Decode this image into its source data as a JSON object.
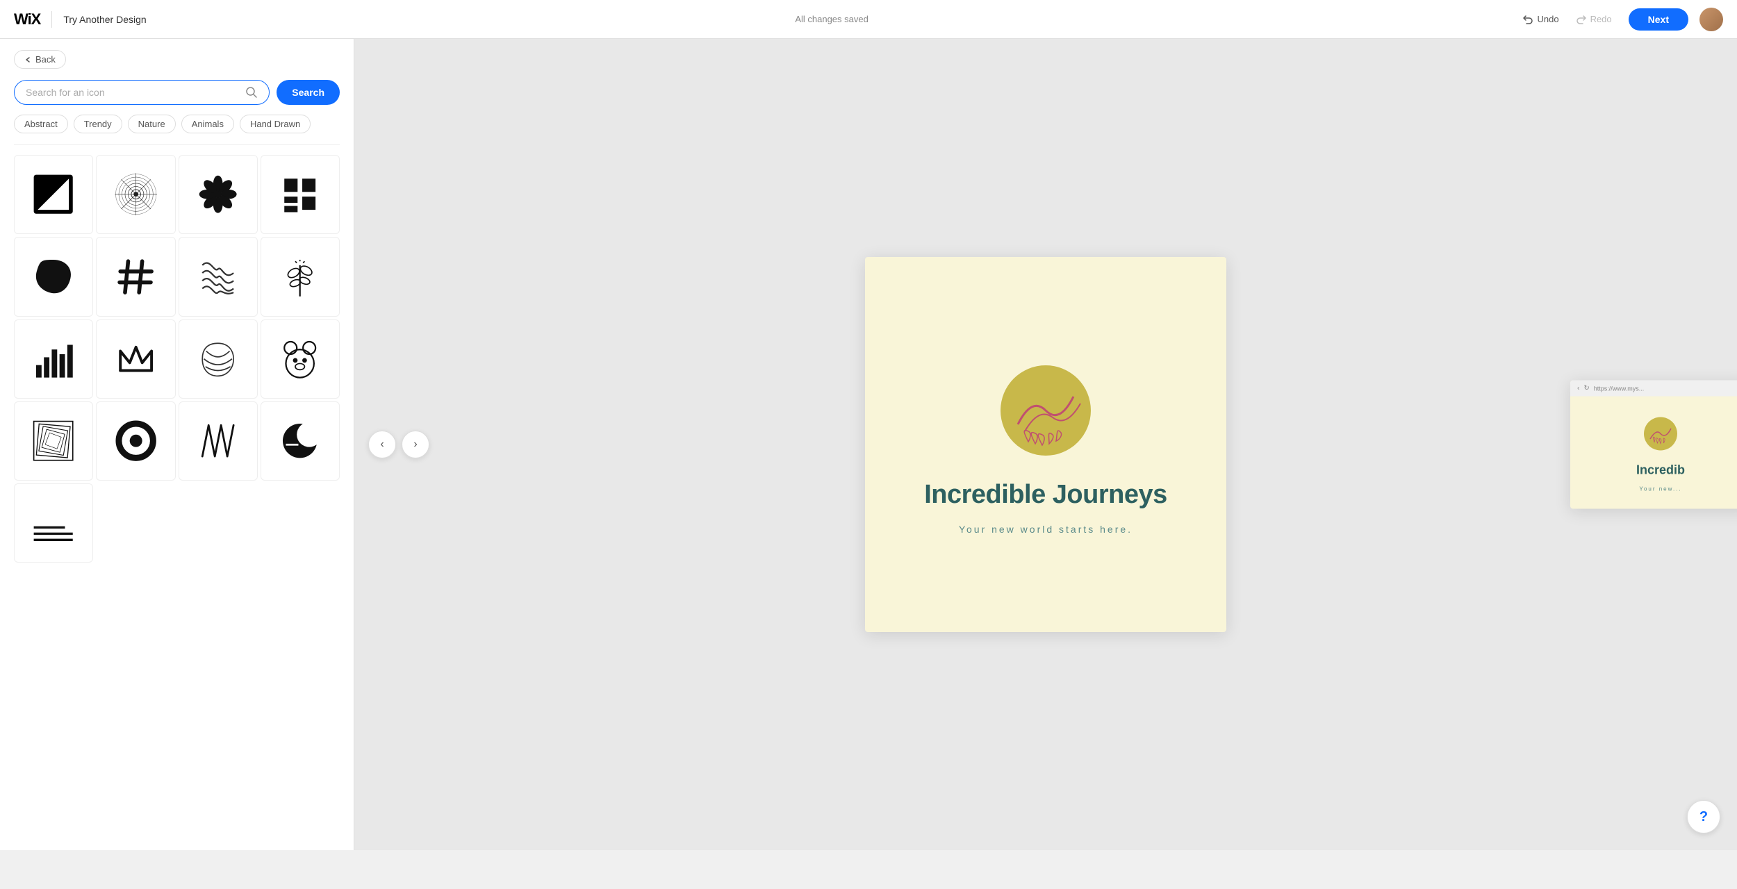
{
  "topbar": {
    "wix_logo": "WiX",
    "try_another": "Try Another Design",
    "status": "All changes saved",
    "undo_label": "Undo",
    "redo_label": "Redo",
    "next_label": "Next"
  },
  "left_panel": {
    "back_label": "Back",
    "search_placeholder": "Search for an icon",
    "search_btn_label": "Search",
    "filter_tags": [
      "Abstract",
      "Trendy",
      "Nature",
      "Animals",
      "Hand Drawn"
    ]
  },
  "logo_card": {
    "title": "Incredible Journeys",
    "subtitle": "Your new world starts here."
  },
  "help": "?"
}
